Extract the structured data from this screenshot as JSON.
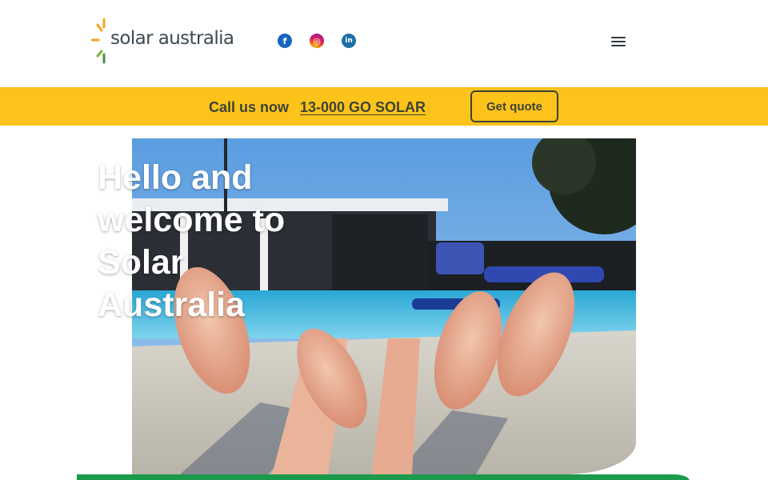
{
  "brand": {
    "name": "solar australia",
    "colors": {
      "sun_orange": "#f5a623",
      "sun_green": "#4a8f3c",
      "text": "#3d4a52"
    }
  },
  "header": {
    "social": [
      {
        "name": "facebook",
        "icon": "facebook-icon",
        "glyph": "f"
      },
      {
        "name": "instagram",
        "icon": "instagram-icon",
        "glyph": "◎"
      },
      {
        "name": "linkedin",
        "icon": "linkedin-icon",
        "glyph": "in"
      }
    ],
    "menu_icon": "hamburger-menu-icon"
  },
  "banner": {
    "call_label": "Call us now",
    "phone": "13-000 GO SOLAR",
    "quote_label": "Get quote",
    "background": "#fcc31b"
  },
  "hero": {
    "title": "Hello and welcome to Solar Australia"
  },
  "accent_bar_color": "#1a9a4a"
}
